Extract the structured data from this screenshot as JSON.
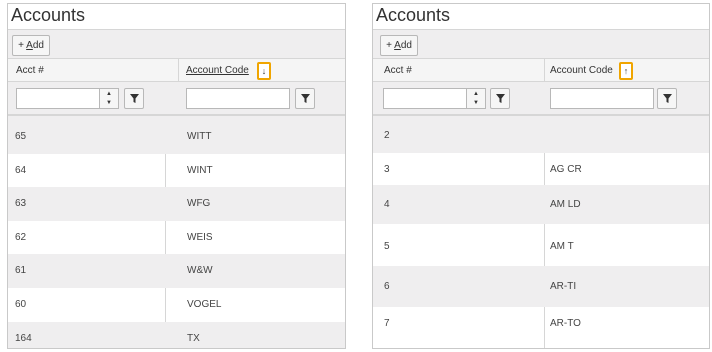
{
  "left": {
    "title": "Accounts",
    "add_label_prefix": "+ ",
    "add_label_key": "A",
    "add_label_rest": "dd",
    "col_acct": "Acct #",
    "col_code": "Account Code",
    "sort_arrow": "↓",
    "acct_filter_value": "",
    "code_filter_value": "",
    "rows": [
      {
        "acct": "65",
        "code": "WITT"
      },
      {
        "acct": "64",
        "code": "WINT"
      },
      {
        "acct": "63",
        "code": "WFG"
      },
      {
        "acct": "62",
        "code": "WEIS"
      },
      {
        "acct": "61",
        "code": "W&W"
      },
      {
        "acct": "60",
        "code": "VOGEL"
      },
      {
        "acct": "164",
        "code": "TX"
      }
    ]
  },
  "right": {
    "title": "Accounts",
    "add_label_prefix": "+ ",
    "add_label_key": "A",
    "add_label_rest": "dd",
    "col_acct": "Acct #",
    "col_code": "Account Code",
    "sort_arrow": "↑",
    "acct_filter_value": "",
    "code_filter_value": "",
    "rows": [
      {
        "acct": "2",
        "code": ""
      },
      {
        "acct": "3",
        "code": "AG CR"
      },
      {
        "acct": "4",
        "code": "AM LD"
      },
      {
        "acct": "5",
        "code": "AM T"
      },
      {
        "acct": "6",
        "code": "AR-TI"
      },
      {
        "acct": "7",
        "code": "AR-TO"
      }
    ]
  },
  "icons": {
    "filter": "filter-icon",
    "spin_up": "chevron-up-icon",
    "spin_down": "chevron-down-icon",
    "sort_desc": "sort-descending-icon",
    "sort_asc": "sort-ascending-icon"
  },
  "colors": {
    "sort_highlight": "#f0a500",
    "toolbar_bg": "#efeeef",
    "alt_row_bg": "#efeeef"
  }
}
